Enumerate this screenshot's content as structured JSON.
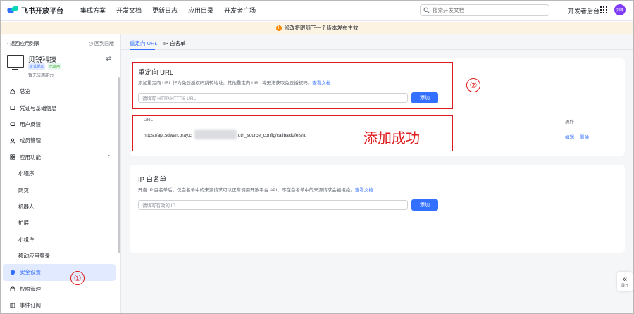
{
  "topnav": {
    "logo_text": "飞书开放平台",
    "items": [
      "集成方案",
      "开发文档",
      "更新日志",
      "应用目录",
      "开发者广场"
    ],
    "search_placeholder": "搜索开发文档",
    "dev_console": "开发者后台",
    "avatar_text": "刘峰"
  },
  "banner": {
    "text": "修改将跟随下一个版本发布生效"
  },
  "sidebar": {
    "back": "返回应用列表",
    "old_version": "回到旧版",
    "app_name": "贝锐科技",
    "tag_official": "正式版本",
    "tag_enabled": "已启用",
    "no_capability": "暂无应用能力",
    "items": [
      {
        "label": "总览"
      },
      {
        "label": "凭证与基础信息"
      },
      {
        "label": "用户反馈"
      },
      {
        "label": "成员管理"
      },
      {
        "label": "应用功能"
      },
      {
        "label": "小程序"
      },
      {
        "label": "网页"
      },
      {
        "label": "机器人"
      },
      {
        "label": "扩展"
      },
      {
        "label": "小组件"
      },
      {
        "label": "移动应用登录"
      },
      {
        "label": "安全设置"
      },
      {
        "label": "权限管理"
      },
      {
        "label": "事件订阅"
      }
    ]
  },
  "tabs": [
    "重定向 URL",
    "IP 白名单"
  ],
  "redirect": {
    "title": "重定向 URL",
    "desc": "添加重定向 URL 作为免登授权码跳转地址。其他重定向 URL 将无法获取免登授权码。",
    "doc_link": "查看文档",
    "input_placeholder": "请填写 HTTP/HTTPS URL",
    "add_label": "添加",
    "col_url": "URL",
    "col_action": "操作",
    "url_prefix": "https://api.sdwan.oray.c",
    "url_suffix": "uth_source_config/callback/feishu",
    "edit_label": "编辑",
    "delete_label": "删除"
  },
  "ipwhitelist": {
    "title": "IP 白名单",
    "desc": "开启 IP 白名单后，仅白名单中的来源请求可以正常调用开放平台 API，不在白名单中的来源请求会被拒绝。",
    "doc_link": "查看文档",
    "input_placeholder": "请填写有效的 IP",
    "add_label": "添加"
  },
  "annotations": {
    "circle1": "①",
    "circle2": "②",
    "success": "添加成功"
  },
  "expand": {
    "label": "展开"
  },
  "colors": {
    "accent": "#3370ff",
    "annotation_red": "#e01b1b",
    "banner_bg": "#fdf3e3"
  }
}
